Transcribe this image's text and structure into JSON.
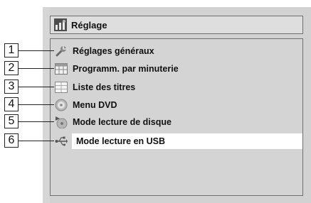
{
  "header": {
    "title": "Réglage",
    "icon": "settings-menu-icon"
  },
  "menu": {
    "items": [
      {
        "number": "1",
        "label": "Réglages généraux",
        "icon": "wrench-icon"
      },
      {
        "number": "2",
        "label": "Programm. par minuterie",
        "icon": "timer-grid-icon"
      },
      {
        "number": "3",
        "label": "Liste des titres",
        "icon": "title-list-icon"
      },
      {
        "number": "4",
        "label": "Menu DVD",
        "icon": "disc-icon"
      },
      {
        "number": "5",
        "label": "Mode lecture de disque",
        "icon": "disc-play-icon"
      },
      {
        "number": "6",
        "label": "Mode lecture en USB",
        "icon": "usb-icon",
        "selected": true
      }
    ]
  },
  "colors": {
    "panel": "#d6d6d6",
    "selected_row": "#ffffff",
    "text": "#111111"
  }
}
